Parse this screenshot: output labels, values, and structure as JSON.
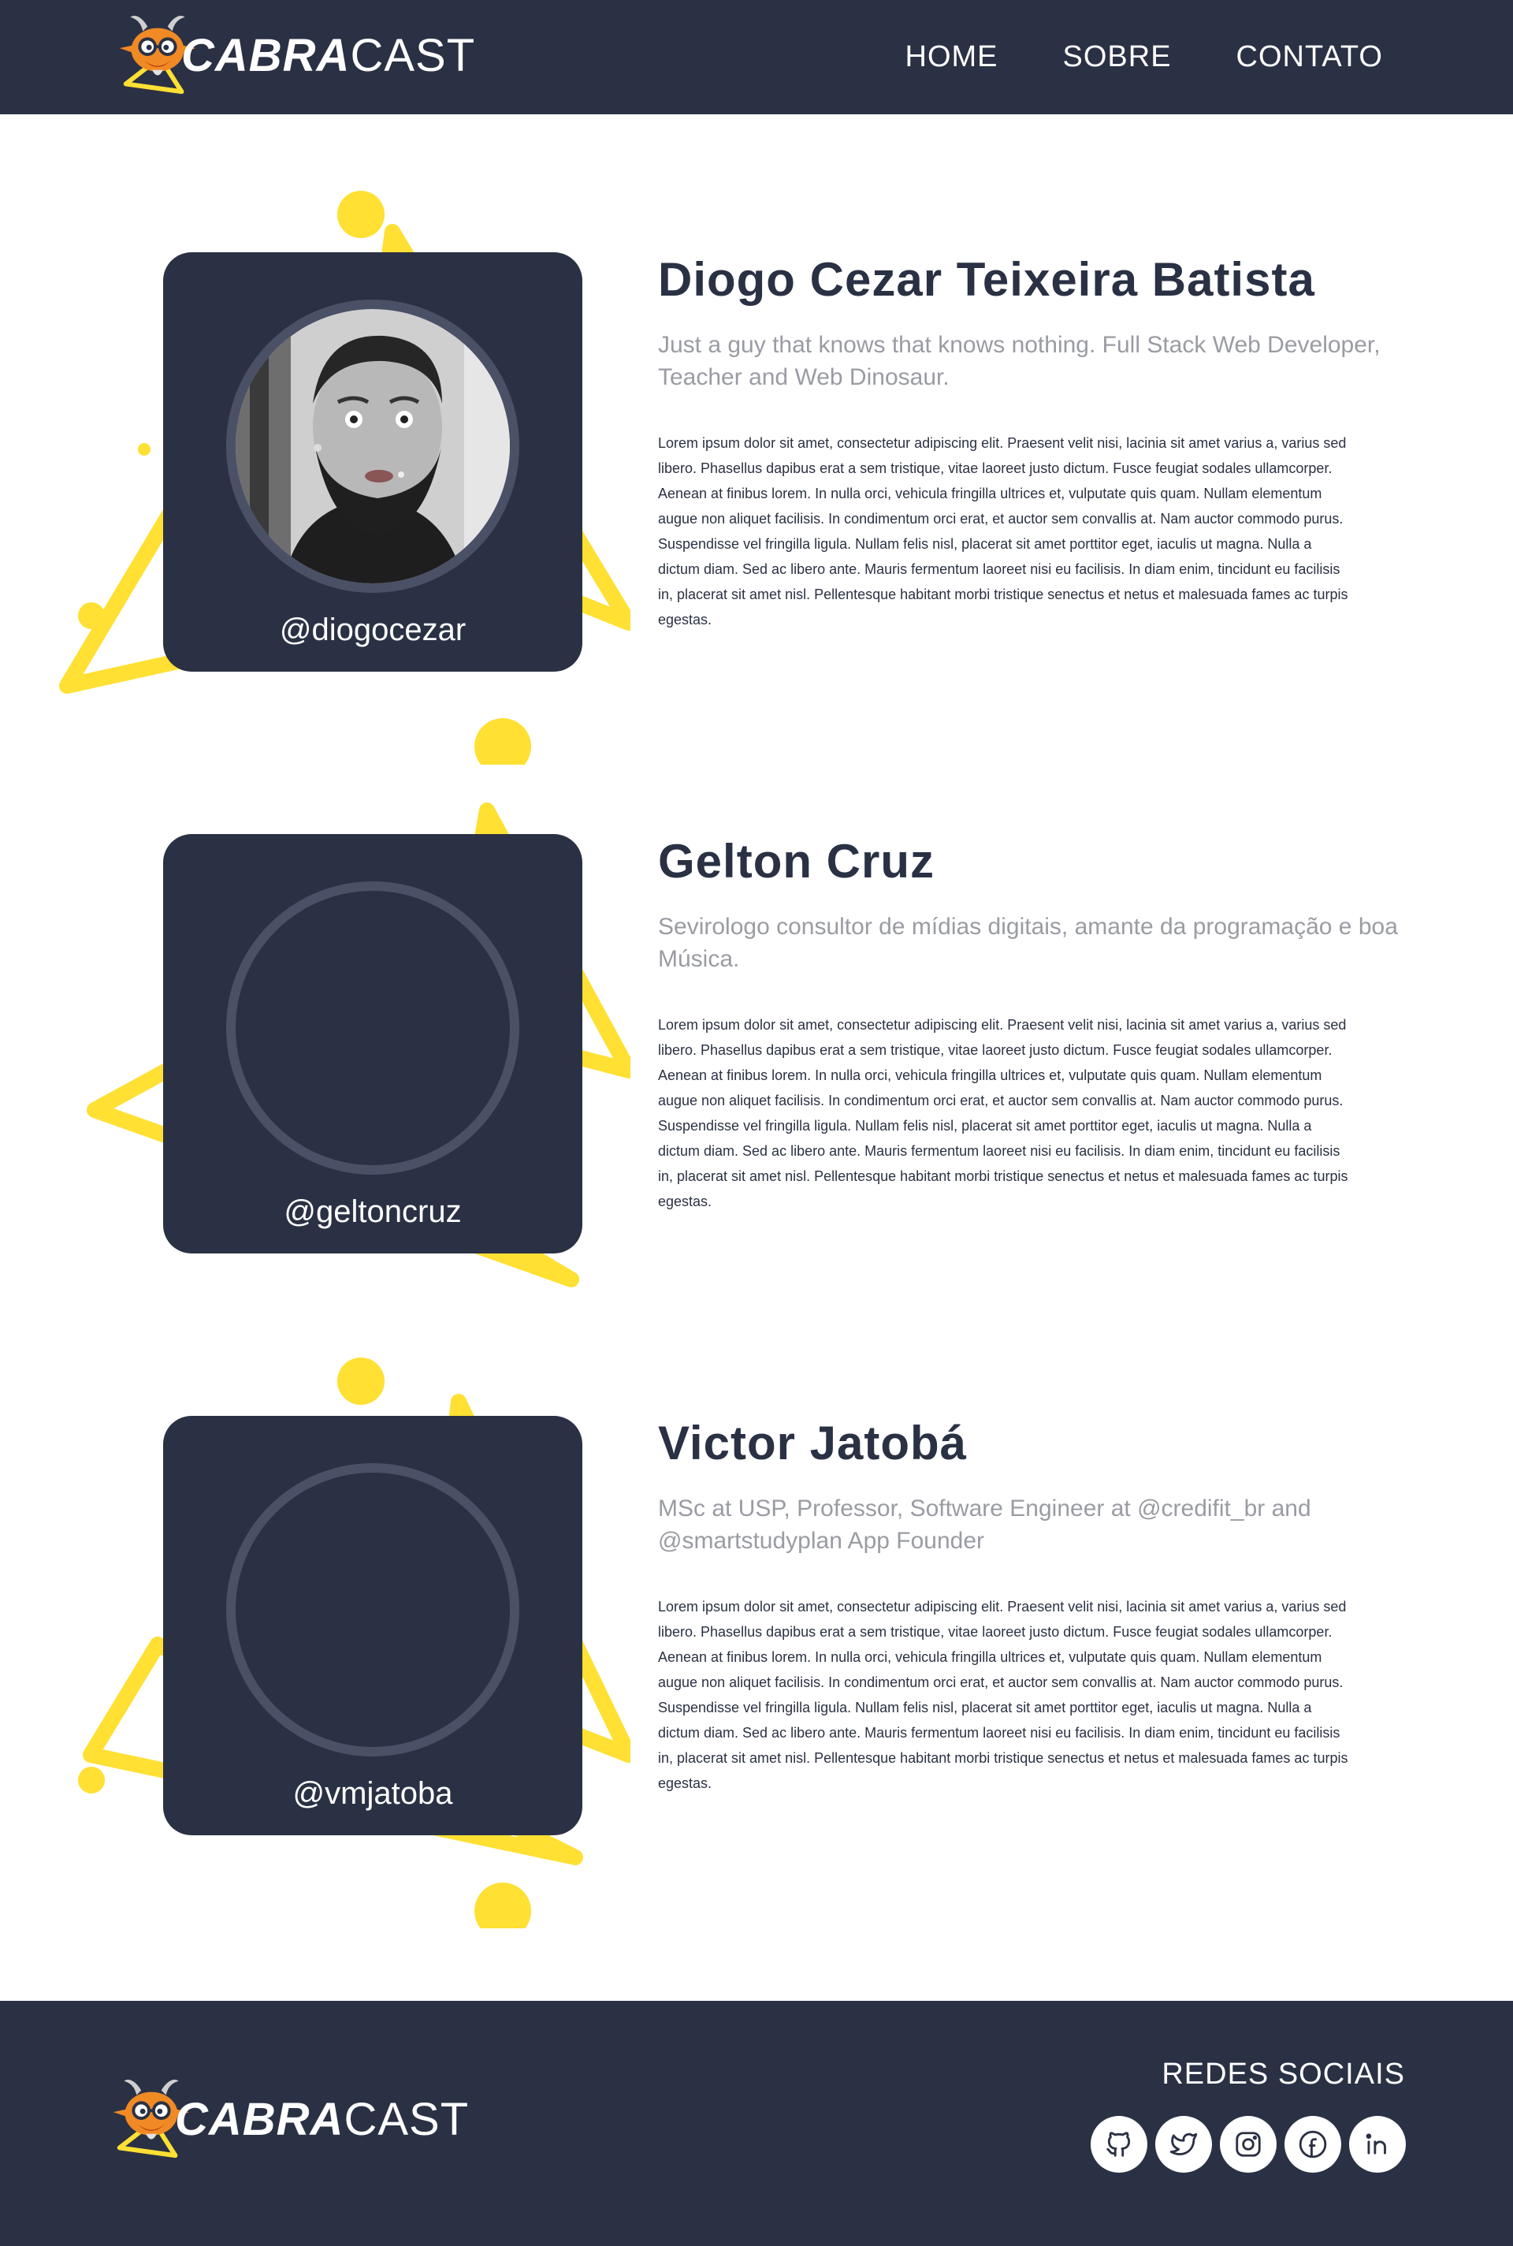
{
  "header": {
    "logo": {
      "bold": "CABRA",
      "light": "CAST"
    },
    "nav": [
      "HOME",
      "SOBRE",
      "CONTATO"
    ]
  },
  "profiles": [
    {
      "name": "Diogo Cezar Teixeira Batista",
      "tagline": "Just a guy that knows that knows nothing. Full Stack Web Developer, Teacher and Web Dinosaur.",
      "bio": "Lorem ipsum dolor sit amet, consectetur adipiscing elit. Praesent velit nisi, lacinia sit amet varius a, varius sed libero. Phasellus dapibus erat a sem tristique, vitae laoreet justo dictum. Fusce feugiat sodales ullamcorper. Aenean at finibus lorem. In nulla orci, vehicula fringilla ultrices et, vulputate quis quam. Nullam elementum augue non aliquet facilisis. In condimentum orci erat, et auctor sem convallis at. Nam auctor commodo purus. Suspendisse vel fringilla ligula. Nullam felis nisl, placerat sit amet porttitor eget, iaculis ut magna. Nulla a dictum diam. Sed ac libero ante. Mauris fermentum laoreet nisi eu facilisis. In diam enim, tincidunt eu facilisis in, placerat sit amet nisl. Pellentesque habitant morbi tristique senectus et netus et malesuada fames ac turpis egestas.",
      "handle": "@diogocezar"
    },
    {
      "name": "Gelton Cruz",
      "tagline": "Sevirologo consultor de mídias digitais, amante da programação e boa Música.",
      "bio": "Lorem ipsum dolor sit amet, consectetur adipiscing elit. Praesent velit nisi, lacinia sit amet varius a, varius sed libero. Phasellus dapibus erat a sem tristique, vitae laoreet justo dictum. Fusce feugiat sodales ullamcorper. Aenean at finibus lorem. In nulla orci, vehicula fringilla ultrices et, vulputate quis quam. Nullam elementum augue non aliquet facilisis. In condimentum orci erat, et auctor sem convallis at. Nam auctor commodo purus. Suspendisse vel fringilla ligula. Nullam felis nisl, placerat sit amet porttitor eget, iaculis ut magna. Nulla a dictum diam. Sed ac libero ante. Mauris fermentum laoreet nisi eu facilisis. In diam enim, tincidunt eu facilisis in, placerat sit amet nisl. Pellentesque habitant morbi tristique senectus et netus et malesuada fames ac turpis egestas.",
      "handle": "@geltoncruz"
    },
    {
      "name": "Victor Jatobá",
      "tagline": "MSc at USP, Professor, Software Engineer at @credifit_br and @smartstudyplan App Founder",
      "bio": "Lorem ipsum dolor sit amet, consectetur adipiscing elit. Praesent velit nisi, lacinia sit amet varius a, varius sed libero. Phasellus dapibus erat a sem tristique, vitae laoreet justo dictum. Fusce feugiat sodales ullamcorper. Aenean at finibus lorem. In nulla orci, vehicula fringilla ultrices et, vulputate quis quam. Nullam elementum augue non aliquet facilisis. In condimentum orci erat, et auctor sem convallis at. Nam auctor commodo purus. Suspendisse vel fringilla ligula. Nullam felis nisl, placerat sit amet porttitor eget, iaculis ut magna. Nulla a dictum diam. Sed ac libero ante. Mauris fermentum laoreet nisi eu facilisis. In diam enim, tincidunt eu facilisis in, placerat sit amet nisl. Pellentesque habitant morbi tristique senectus et netus et malesuada fames ac turpis egestas.",
      "handle": "@vmjatoba"
    }
  ],
  "footer": {
    "logo": {
      "bold": "CABRA",
      "light": "CAST"
    },
    "social_title": "REDES SOCIAIS",
    "social_icons": [
      "github-icon",
      "twitter-icon",
      "instagram-icon",
      "facebook-icon",
      "linkedin-icon"
    ]
  },
  "colors": {
    "navy": "#2b3144",
    "accent_yellow": "#ffe033",
    "ring": "#4a5066",
    "tagline_gray": "#9a9ca3"
  }
}
